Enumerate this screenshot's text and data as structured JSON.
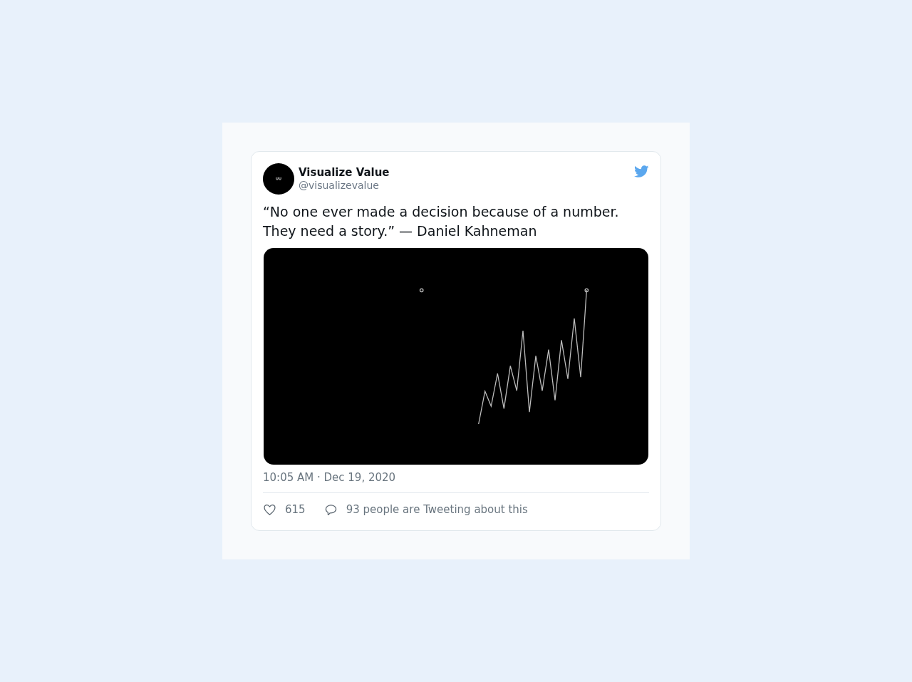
{
  "tweet": {
    "author": {
      "name": "Visualize Value",
      "handle": "@visualizevalue"
    },
    "text": "“No one ever made a decision because of a number. They need a story.” — Daniel Kahneman",
    "timestamp": "10:05 AM · Dec 19, 2020",
    "likes": "615",
    "conversation": "93 people are Tweeting about this"
  }
}
